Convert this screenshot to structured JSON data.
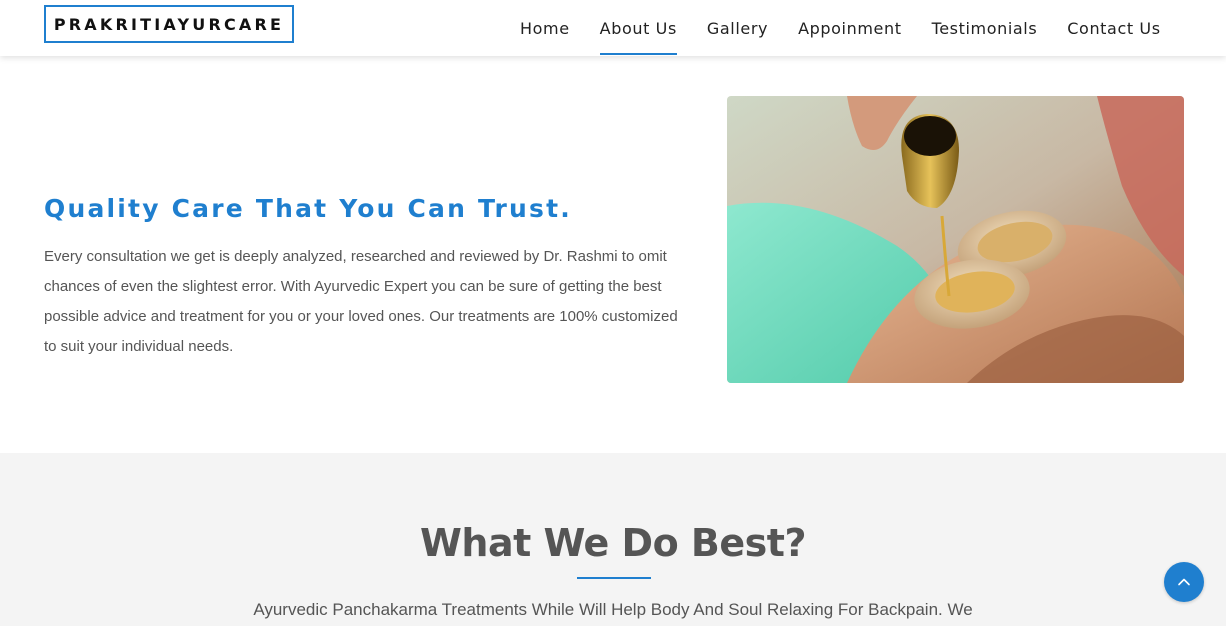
{
  "header": {
    "logo_text": "PRAKRITIAYURCARE",
    "nav": [
      {
        "label": "Home",
        "active": false
      },
      {
        "label": "About Us",
        "active": true
      },
      {
        "label": "Gallery",
        "active": false
      },
      {
        "label": "Appoinment",
        "active": false
      },
      {
        "label": "Testimonials",
        "active": false
      },
      {
        "label": "Contact Us",
        "active": false
      }
    ]
  },
  "intro": {
    "title": "Quality Care That You Can Trust.",
    "text": "Every consultation we get is deeply analyzed, researched and reviewed by Dr. Rashmi to omit chances of even the slightest error. With Ayurvedic Expert you can be sure of getting the best possible advice and treatment for you or your loved ones. Our treatments are 100% customized to suit your individual needs."
  },
  "best": {
    "title": "What We Do Best?",
    "text": "Ayurvedic Panchakarma Treatments While Will Help Body And Soul Relaxing For Backpain. We"
  },
  "icons": {
    "scroll_top": "chevron-up-icon"
  },
  "colors": {
    "accent": "#1f7fcf",
    "heading_gray": "#555555",
    "section_bg": "#f4f4f4"
  }
}
